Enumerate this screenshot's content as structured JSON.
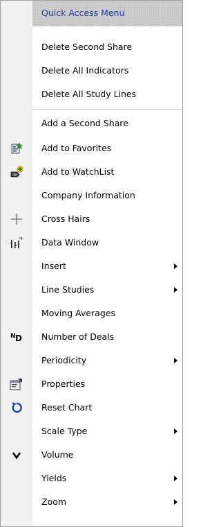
{
  "menu": {
    "header_label": "Quick Access Menu",
    "items": [
      {
        "label": "Delete Second Share"
      },
      {
        "label": "Delete All Indicators"
      },
      {
        "label": "Delete All Study Lines"
      },
      {
        "label": "Add a Second Share"
      },
      {
        "label": "Add to Favorites",
        "icon": "favorites-icon"
      },
      {
        "label": "Add to WatchList",
        "icon": "watchlist-add-icon"
      },
      {
        "label": "Company Information"
      },
      {
        "label": "Cross Hairs",
        "icon": "crosshair-icon"
      },
      {
        "label": "Data Window",
        "icon": "data-window-icon"
      },
      {
        "label": "Insert",
        "submenu": true
      },
      {
        "label": "Line Studies",
        "submenu": true
      },
      {
        "label": "Moving Averages"
      },
      {
        "label": "Number of Deals",
        "icon": "number-of-deals-icon"
      },
      {
        "label": "Periodicity",
        "submenu": true
      },
      {
        "label": "Properties",
        "icon": "properties-icon"
      },
      {
        "label": "Reset Chart",
        "icon": "reset-icon"
      },
      {
        "label": "Scale Type",
        "submenu": true
      },
      {
        "label": "Volume",
        "icon": "volume-icon"
      },
      {
        "label": "Yields",
        "submenu": true
      },
      {
        "label": "Zoom",
        "submenu": true
      }
    ]
  },
  "colors": {
    "header_text": "#1d3d9c",
    "reset_icon": "#1f3fa8"
  }
}
